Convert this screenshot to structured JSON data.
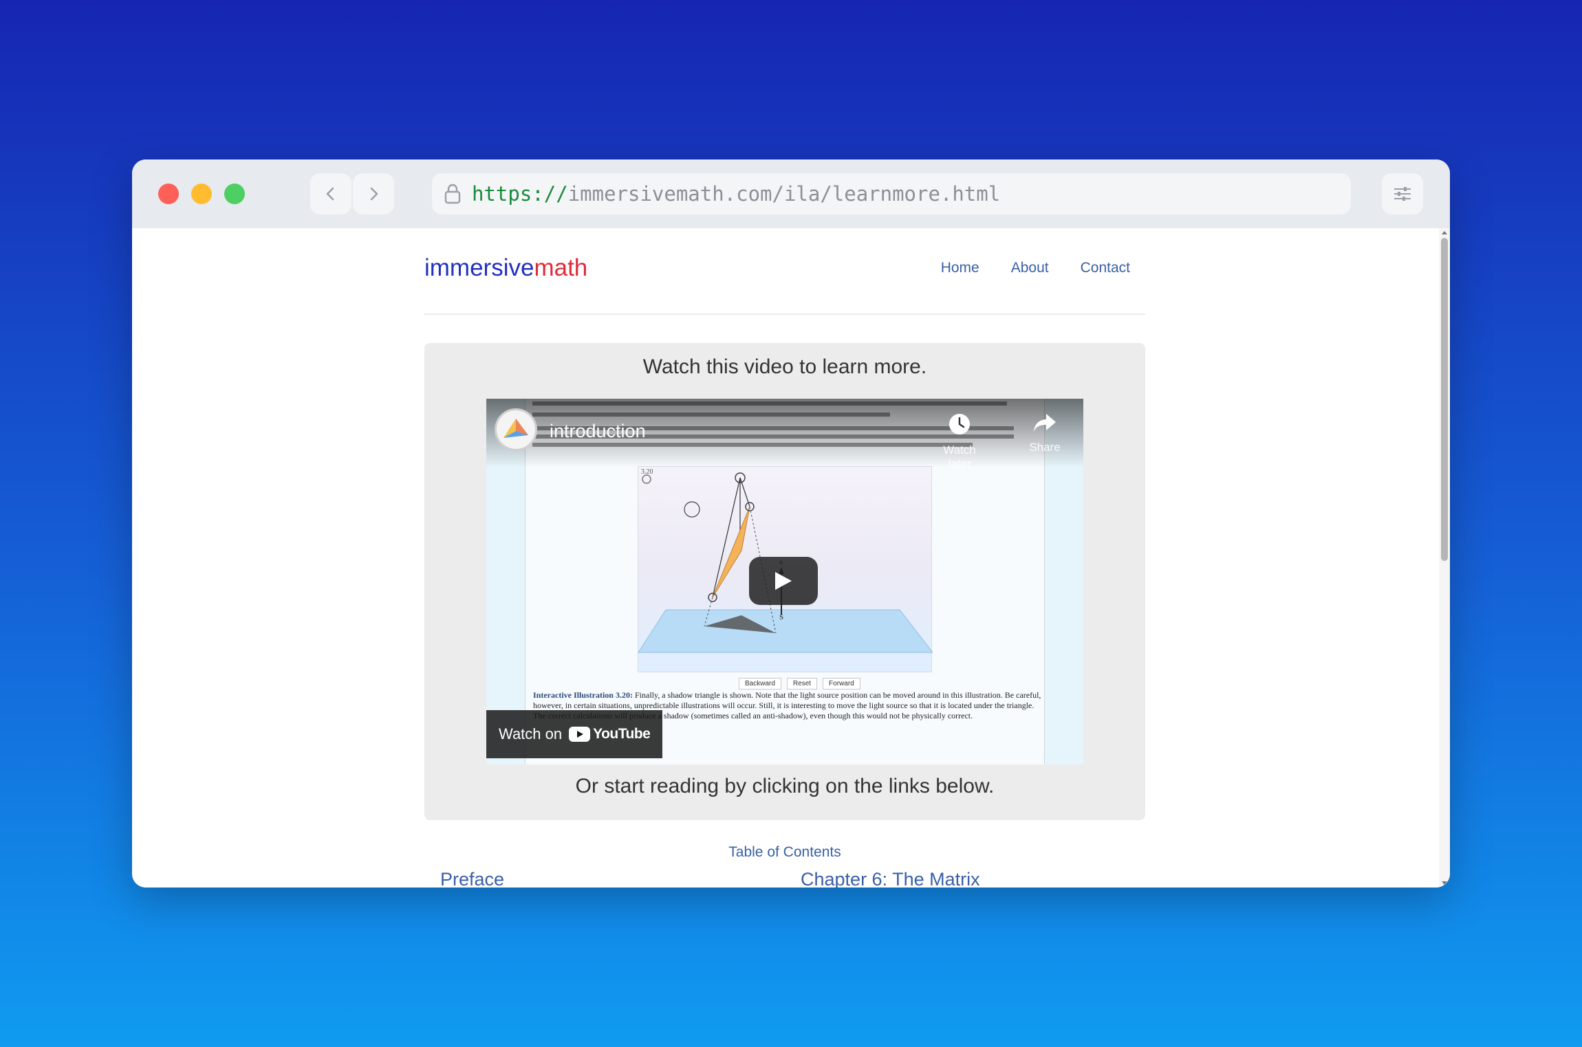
{
  "browser": {
    "url_scheme": "https://",
    "url_rest": "immersivemath.com/ila/learnmore.html"
  },
  "site": {
    "brand_part1": "immersive",
    "brand_part2": "math",
    "nav": [
      "Home",
      "About",
      "Contact"
    ]
  },
  "panel": {
    "heading": "Watch this video to learn more.",
    "subheading": "Or start reading by clicking on the links below."
  },
  "video": {
    "title": "introduction",
    "watch_later_label": "Watch later",
    "share_label": "Share",
    "watch_on_label": "Watch on",
    "youtube_label": "YouTube",
    "illustration_buttons": [
      "Backward",
      "Reset",
      "Forward"
    ],
    "caption_label": "Interactive Illustration 3.20:",
    "caption_text": "Finally, a shadow triangle is shown. Note that the light source position can be moved around in this illustration. Be careful, however, in certain situations, unpredictable illustrations will occur. Still, it is interesting to move the light source so that it is located under the triangle. The correct calculations will produce a shadow (sometimes called an anti-shadow), even though this would not be physically correct.",
    "figure_number": "3.20"
  },
  "toc": {
    "title": "Table of Contents",
    "left_item": "Preface",
    "right_item": "Chapter 6: The Matrix"
  },
  "colors": {
    "brand_blue": "#2230c0",
    "brand_red": "#e02a3a",
    "link": "#3a5fa6",
    "panel_bg": "#ececec"
  }
}
